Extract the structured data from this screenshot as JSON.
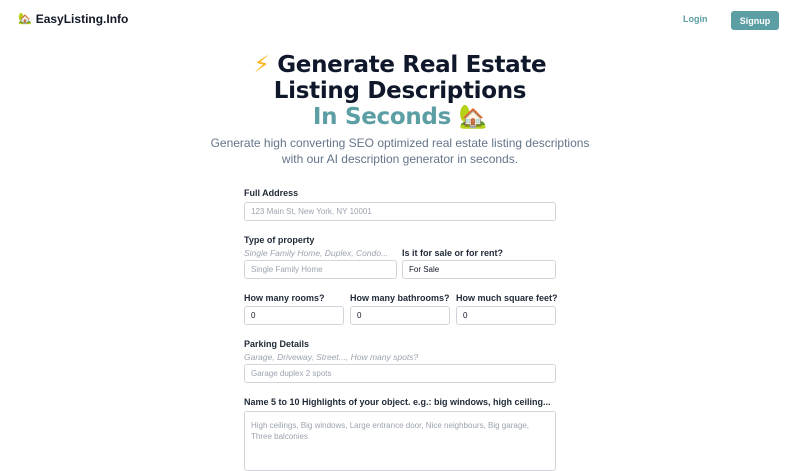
{
  "header": {
    "brand_icon": "🏡",
    "brand_name": "EasyListing.Info",
    "login_label": "Login",
    "signup_label": "Signup",
    "accent_color": "#5b9ea3"
  },
  "hero": {
    "bolt": "⚡",
    "line1": "Generate Real Estate",
    "line2": "Listing Descriptions",
    "accent_line": "In Seconds",
    "house_icon": "🏡",
    "subtitle": "Generate high converting SEO optimized real estate listing descriptions with our AI description generator in seconds."
  },
  "form": {
    "address": {
      "label": "Full Address",
      "placeholder": "123 Main St, New York, NY 10001"
    },
    "property_type": {
      "label": "Type of property",
      "hint": "Single Family Home, Duplex, Condo...",
      "placeholder": "Single Family Home"
    },
    "sale_or_rent": {
      "label": "Is it for sale or for rent?",
      "value": "For Sale"
    },
    "rooms": {
      "label": "How many rooms?",
      "value": "0"
    },
    "bathrooms": {
      "label": "How many bathrooms?",
      "value": "0"
    },
    "square_feet": {
      "label": "How much square feet?",
      "value": "0"
    },
    "parking": {
      "label": "Parking Details",
      "hint": "Garage, Driveway, Street..., How many spots?",
      "placeholder": "Garage duplex 2 spots"
    },
    "highlights": {
      "label": "Name 5 to 10 Highlights of your object. e.g.: big windows, high ceiling...",
      "placeholder": "High ceilings, Big windows, Large entrance door, Nice neighbours, Big garage, Three balconies"
    }
  }
}
